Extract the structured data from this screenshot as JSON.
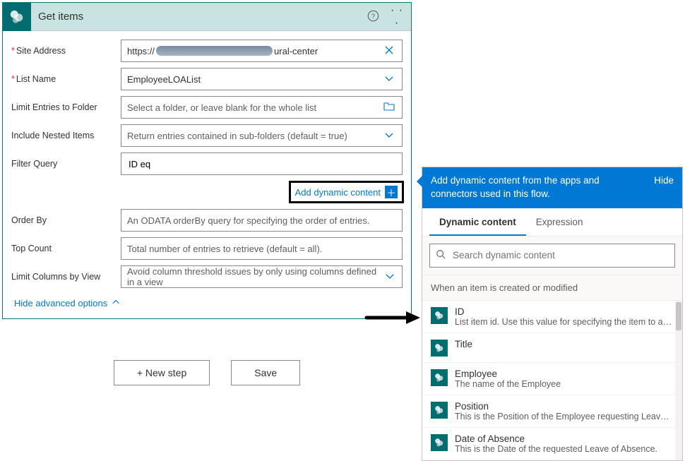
{
  "card": {
    "title": "Get items",
    "help_aria": "Help",
    "more_aria": "More options"
  },
  "fields": {
    "site_address": {
      "label": "Site Address",
      "value_prefix": "https://",
      "value_suffix": "ural-center",
      "clear_icon": "clear"
    },
    "list_name": {
      "label": "List Name",
      "value": "EmployeeLOAList"
    },
    "limit_folder": {
      "label": "Limit Entries to Folder",
      "placeholder": "Select a folder, or leave blank for the whole list"
    },
    "nested": {
      "label": "Include Nested Items",
      "value": "Return entries contained in sub-folders (default = true)"
    },
    "filter": {
      "label": "Filter Query",
      "value": "ID eq"
    },
    "add_dynamic": "Add dynamic content",
    "order_by": {
      "label": "Order By",
      "placeholder": "An ODATA orderBy query for specifying the order of entries."
    },
    "top_count": {
      "label": "Top Count",
      "placeholder": "Total number of entries to retrieve (default = all)."
    },
    "limit_cols": {
      "label": "Limit Columns by View",
      "value": "Avoid column threshold issues by only using columns defined in a view"
    }
  },
  "hide_advanced": "Hide advanced options",
  "buttons": {
    "new_step": "+ New step",
    "save": "Save"
  },
  "dyn": {
    "header": "Add dynamic content from the apps and connectors used in this flow.",
    "hide": "Hide",
    "tabs": {
      "dynamic": "Dynamic content",
      "expression": "Expression"
    },
    "search_placeholder": "Search dynamic content",
    "group": "When an item is created or modified",
    "items": [
      {
        "title": "ID",
        "desc": "List item id. Use this value for specifying the item to act o..."
      },
      {
        "title": "Title",
        "desc": ""
      },
      {
        "title": "Employee",
        "desc": "The name of the Employee"
      },
      {
        "title": "Position",
        "desc": "This is the Position of the Employee requesting Leave of A..."
      },
      {
        "title": "Date of Absence",
        "desc": "This is the Date of the requested Leave of Absence."
      }
    ]
  }
}
